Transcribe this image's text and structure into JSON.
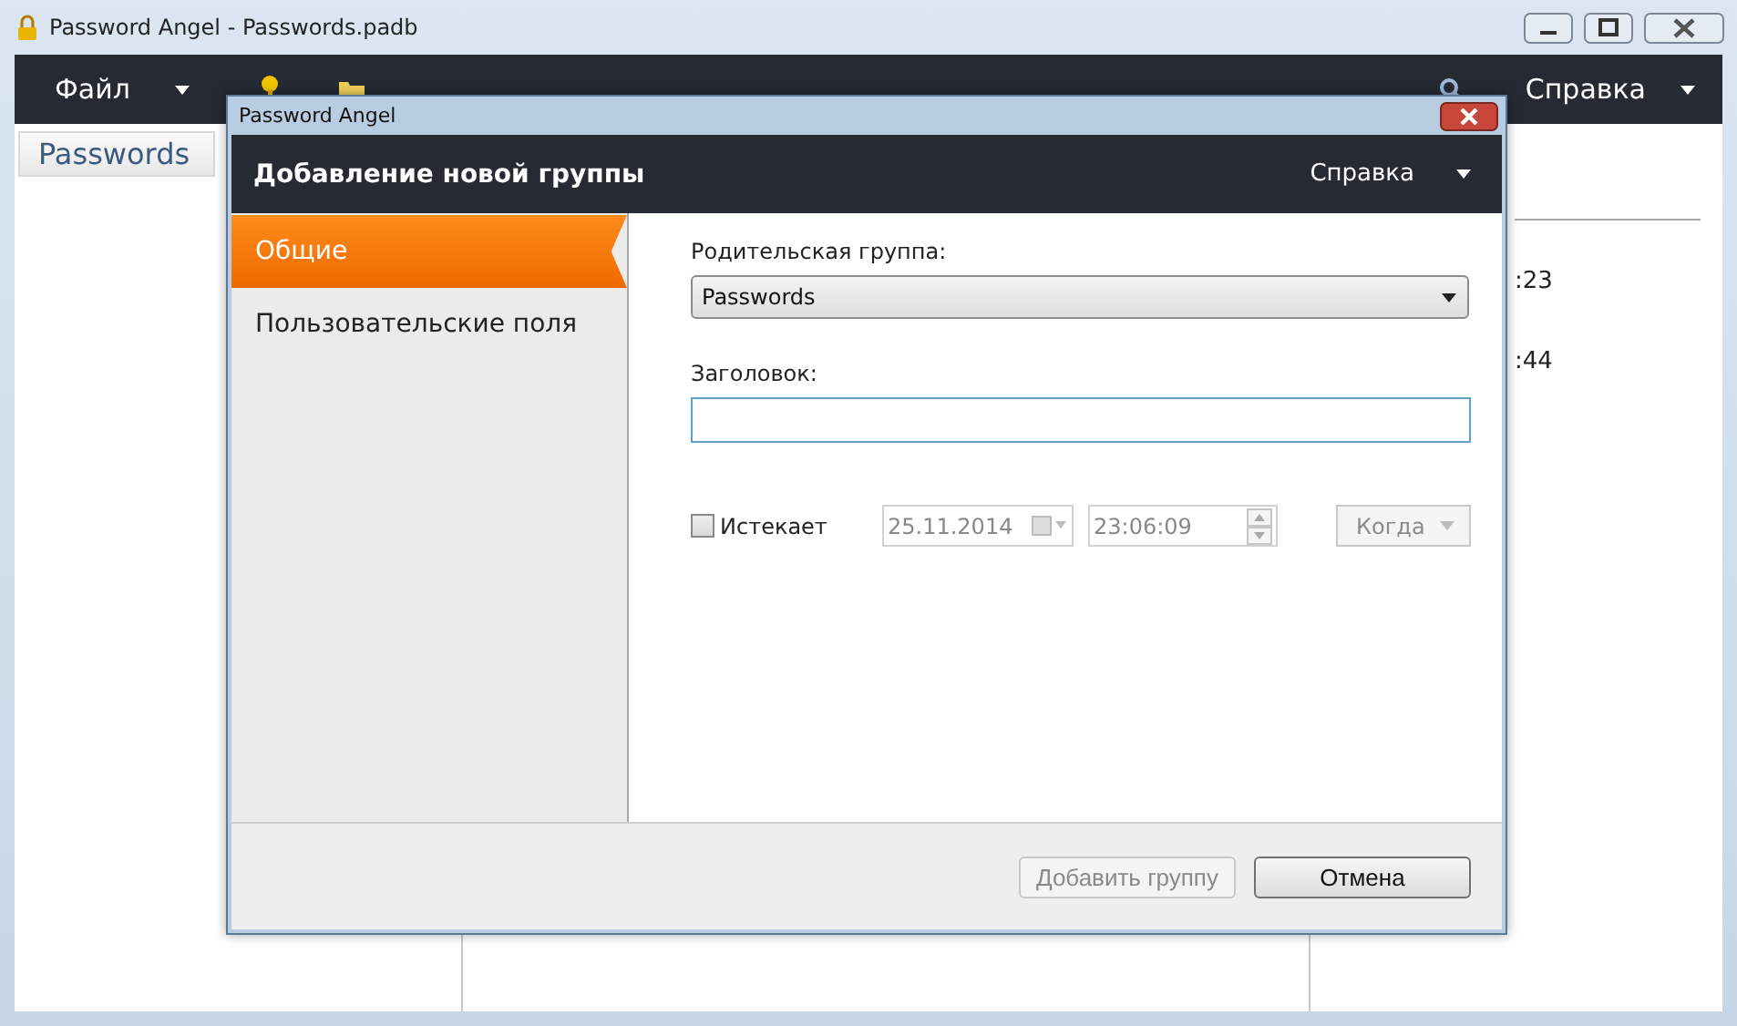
{
  "window": {
    "title": "Password Angel - Passwords.padb"
  },
  "menu_bar": {
    "items": [
      {
        "label": "Файл"
      }
    ],
    "help": "Справка"
  },
  "tabs": [
    {
      "label": "Passwords",
      "selected": true
    }
  ],
  "entries": [
    {
      "time": ":23"
    },
    {
      "time": ":44"
    }
  ],
  "dialog": {
    "title": "Password Angel",
    "header": "Добавление новой группы",
    "help": "Справка",
    "nav": [
      {
        "label": "Общие",
        "selected": true
      },
      {
        "label": "Пользовательские поля",
        "selected": false
      }
    ],
    "parent_group": {
      "label": "Родительская группа:",
      "value": "Passwords"
    },
    "title_field": {
      "label": "Заголовок:",
      "focused": true
    },
    "expires": {
      "label": "Истекает",
      "checked": false,
      "disabled": true,
      "date": "25.11.2014",
      "time": "23:06:09",
      "when": "Когда"
    },
    "buttons": [
      {
        "label": "Добавить группу",
        "disabled": true
      },
      {
        "label": "Отмена",
        "disabled": false
      }
    ]
  }
}
